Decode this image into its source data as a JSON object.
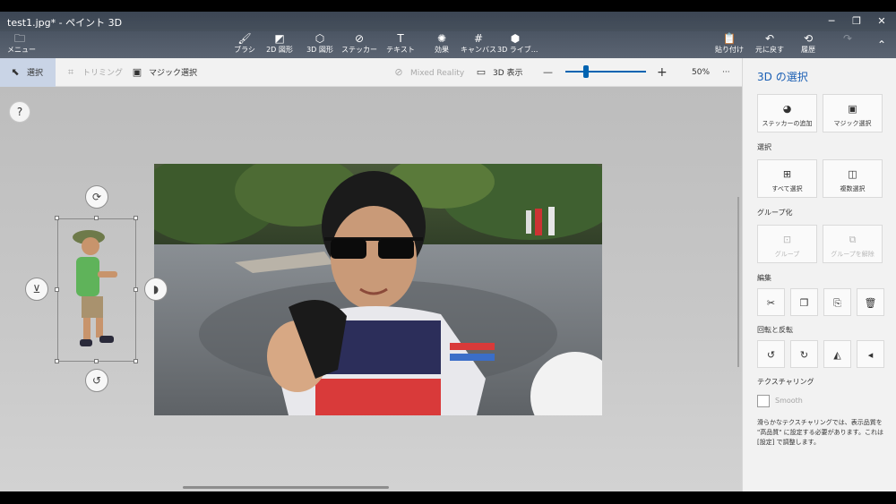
{
  "window": {
    "title": "test1.jpg* - ペイント 3D",
    "controls": [
      "minimize-icon",
      "maximize-icon",
      "close-icon"
    ]
  },
  "ribbon": {
    "menu_label": "メニュー",
    "tools": [
      {
        "label": "ブラシ",
        "icon": "brush-icon",
        "glyph": "🖌"
      },
      {
        "label": "2D 図形",
        "icon": "2d-shapes-icon",
        "glyph": "◩"
      },
      {
        "label": "3D 図形",
        "icon": "3d-shapes-icon",
        "glyph": "⬡"
      },
      {
        "label": "ステッカー",
        "icon": "sticker-icon",
        "glyph": "⊘"
      },
      {
        "label": "テキスト",
        "icon": "text-icon",
        "glyph": "T"
      },
      {
        "label": "効果",
        "icon": "effects-icon",
        "glyph": "✺"
      },
      {
        "label": "キャンバス",
        "icon": "canvas-icon",
        "glyph": "#"
      },
      {
        "label": "3D ライブ...",
        "icon": "3d-library-icon",
        "glyph": "⬢"
      }
    ],
    "right": [
      {
        "label": "貼り付け",
        "icon": "paste-icon",
        "glyph": "📋"
      },
      {
        "label": "元に戻す",
        "icon": "undo-icon",
        "glyph": "↶"
      },
      {
        "label": "履歴",
        "icon": "history-icon",
        "glyph": "⟲"
      },
      {
        "label": "",
        "icon": "redo-icon",
        "glyph": "↷"
      }
    ]
  },
  "toolbar": {
    "select_label": "選択",
    "crop_label": "トリミング",
    "magic_select_label": "マジック選択",
    "mixed_reality_label": "Mixed Reality",
    "view3d_label": "3D 表示",
    "zoom_minus": "—",
    "zoom_plus": "+",
    "zoom_value": "50%",
    "zoom_fraction": 0.25,
    "more": "···"
  },
  "canvas": {
    "help": "?"
  },
  "panel": {
    "title": "3D の選択",
    "top_buttons": [
      {
        "label": "ステッカーの追加",
        "icon": "add-sticker-icon",
        "glyph": "◕"
      },
      {
        "label": "マジック選択",
        "icon": "magic-select-icon",
        "glyph": "▣"
      }
    ],
    "select_section": "選択",
    "select_buttons": [
      {
        "label": "すべて選択",
        "icon": "select-all-icon",
        "glyph": "⊞"
      },
      {
        "label": "複数選択",
        "icon": "multi-select-icon",
        "glyph": "◫"
      }
    ],
    "group_section": "グループ化",
    "group_buttons": [
      {
        "label": "グループ",
        "icon": "group-icon",
        "glyph": "⊡"
      },
      {
        "label": "グループを解除",
        "icon": "ungroup-icon",
        "glyph": "⧉"
      }
    ],
    "edit_section": "編集",
    "edit_buttons": [
      {
        "icon": "cut-icon",
        "glyph": "✂"
      },
      {
        "icon": "copy-icon",
        "glyph": "❐"
      },
      {
        "icon": "paste-icon",
        "glyph": "⎘"
      },
      {
        "icon": "delete-icon",
        "glyph": "🗑"
      }
    ],
    "rotate_section": "回転と反転",
    "rotate_buttons": [
      {
        "icon": "rotate-left-icon",
        "glyph": "↺"
      },
      {
        "icon": "rotate-right-icon",
        "glyph": "↻"
      },
      {
        "icon": "flip-horizontal-icon",
        "glyph": "◭"
      },
      {
        "icon": "flip-vertical-icon",
        "glyph": "◂"
      }
    ],
    "texture_section": "テクスチャリング",
    "smooth_label": "Smooth",
    "note": "滑らかなテクスチャリングでは、表示品質を \"高品質\" に設定する必要があります。これは [設定] で調整します。"
  }
}
